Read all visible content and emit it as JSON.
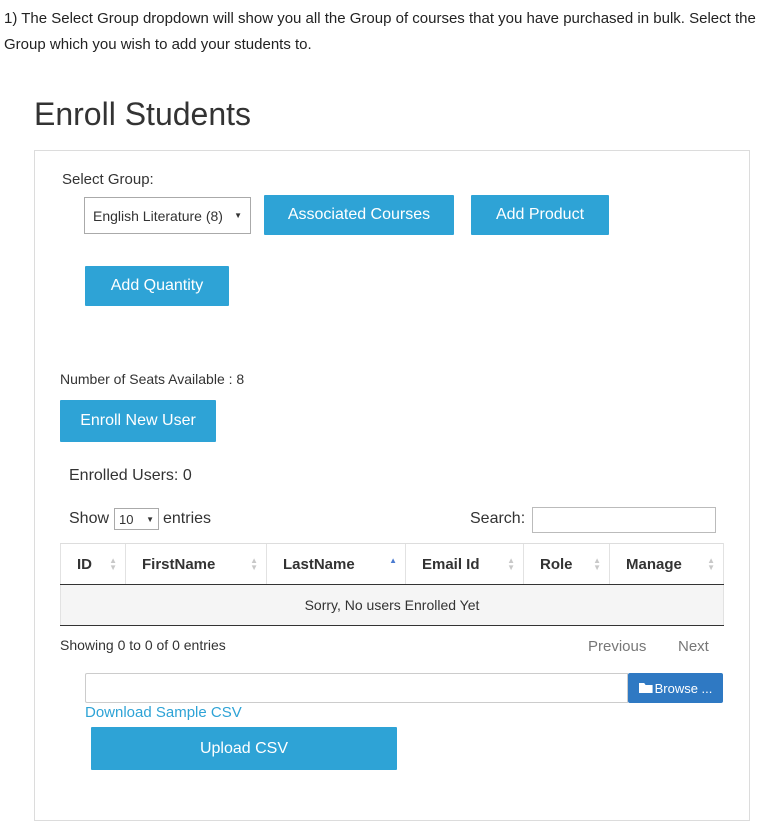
{
  "intro": {
    "text": "1) The Select Group dropdown will show you all the Group of courses that you have purchased in bulk. Select the Group which you wish to add your students to."
  },
  "page": {
    "title": "Enroll Students"
  },
  "group": {
    "label": "Select Group:",
    "selected": "English Literature (8)",
    "associated_courses_label": "Associated Courses",
    "add_product_label": "Add Product",
    "add_quantity_label": "Add Quantity"
  },
  "seats": {
    "text": "Number of Seats Available : 8"
  },
  "enroll": {
    "button_label": "Enroll New User",
    "enrolled_count_text": "Enrolled Users: 0"
  },
  "table_controls": {
    "show_label": "Show",
    "page_size": "10",
    "entries_label": "entries",
    "search_label": "Search:",
    "search_value": ""
  },
  "table": {
    "columns": [
      "ID",
      "FirstName",
      "LastName",
      "Email Id",
      "Role",
      "Manage"
    ],
    "sorted_column": "LastName",
    "empty_message": "Sorry, No users Enrolled Yet"
  },
  "pagination": {
    "info": "Showing 0 to 0 of 0 entries",
    "previous_label": "Previous",
    "next_label": "Next"
  },
  "upload": {
    "file_value": "",
    "browse_label": "Browse ...",
    "download_link": "Download Sample CSV",
    "upload_button": "Upload CSV"
  },
  "colors": {
    "primary": "#2ea3d6",
    "browse": "#2f79c3",
    "link": "#2ea3d6"
  }
}
